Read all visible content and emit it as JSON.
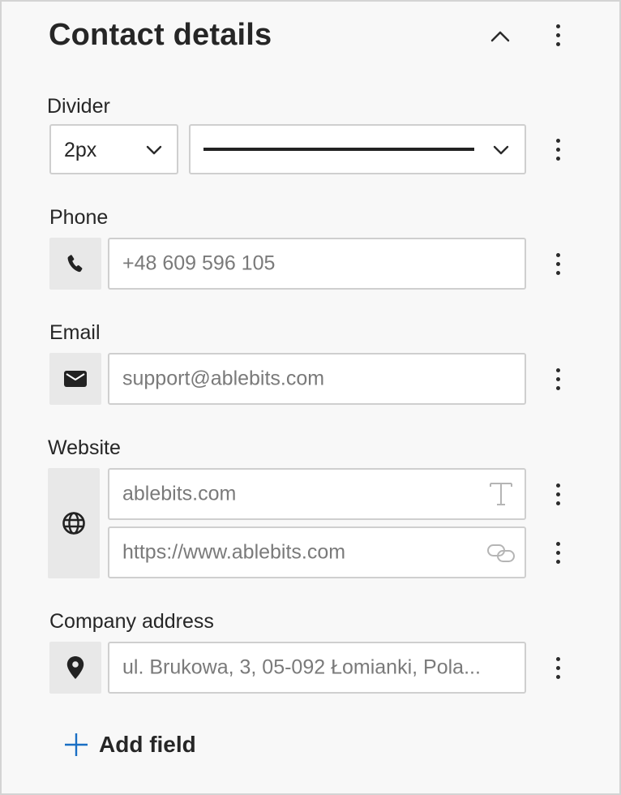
{
  "panel": {
    "title": "Contact details"
  },
  "divider": {
    "label": "Divider",
    "width_value": "2px",
    "style_value": "solid line"
  },
  "phone": {
    "label": "Phone",
    "placeholder": "+48 609 596 105",
    "icon": "phone-icon"
  },
  "email": {
    "label": "Email",
    "placeholder": "support@ablebits.com",
    "icon": "envelope-icon"
  },
  "website": {
    "label": "Website",
    "text_placeholder": "ablebits.com",
    "url_placeholder": "https://www.ablebits.com",
    "icon": "globe-icon",
    "text_field_icon": "text-format-icon",
    "url_field_icon": "link-icon"
  },
  "address": {
    "label": "Company address",
    "placeholder": "ul. Brukowa, 3, 05-092 Łomianki, Pola...",
    "icon": "map-pin-icon"
  },
  "actions": {
    "add_field_label": "Add field"
  },
  "colors": {
    "panel_bg": "#f8f8f8",
    "accent_plus": "#1a6fc4",
    "icon_cell_bg": "#e8e8e8"
  }
}
